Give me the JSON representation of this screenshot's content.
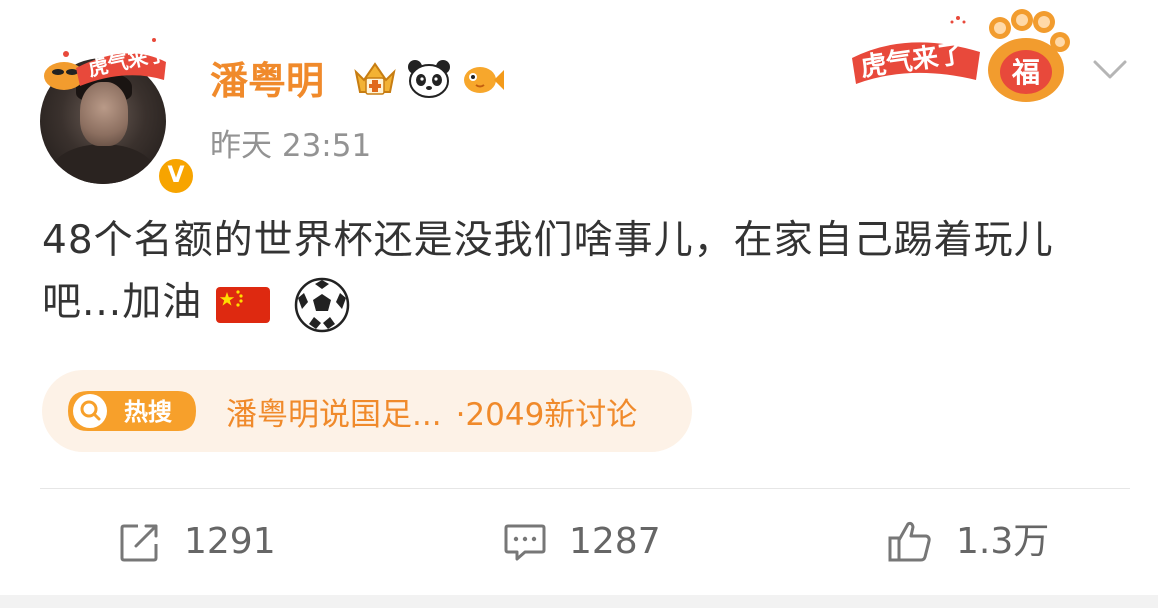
{
  "post": {
    "author": "潘粤明",
    "verified_mark": "V",
    "timestamp": "昨天 23:51",
    "text_main": "48个名额的世界杯还是没我们啥事儿，在家自己踢着玩儿吧...加油",
    "emojis": [
      "china-flag-icon",
      "soccer-ball-icon"
    ]
  },
  "festive": {
    "banner_text": "虎气来了",
    "paw_text": "福"
  },
  "avatar": {
    "pendant_text": "虎气来了"
  },
  "hot_topic": {
    "tag_label": "热搜",
    "topic": "潘粤明说国足...",
    "discussion": "·2049新讨论"
  },
  "actions": {
    "repost_count": "1291",
    "comment_count": "1287",
    "like_count": "1.3万"
  },
  "colors": {
    "username": "#f08a2b",
    "verified": "#f7a400",
    "hot_bg": "#fdf2e7",
    "muted": "#939393"
  }
}
